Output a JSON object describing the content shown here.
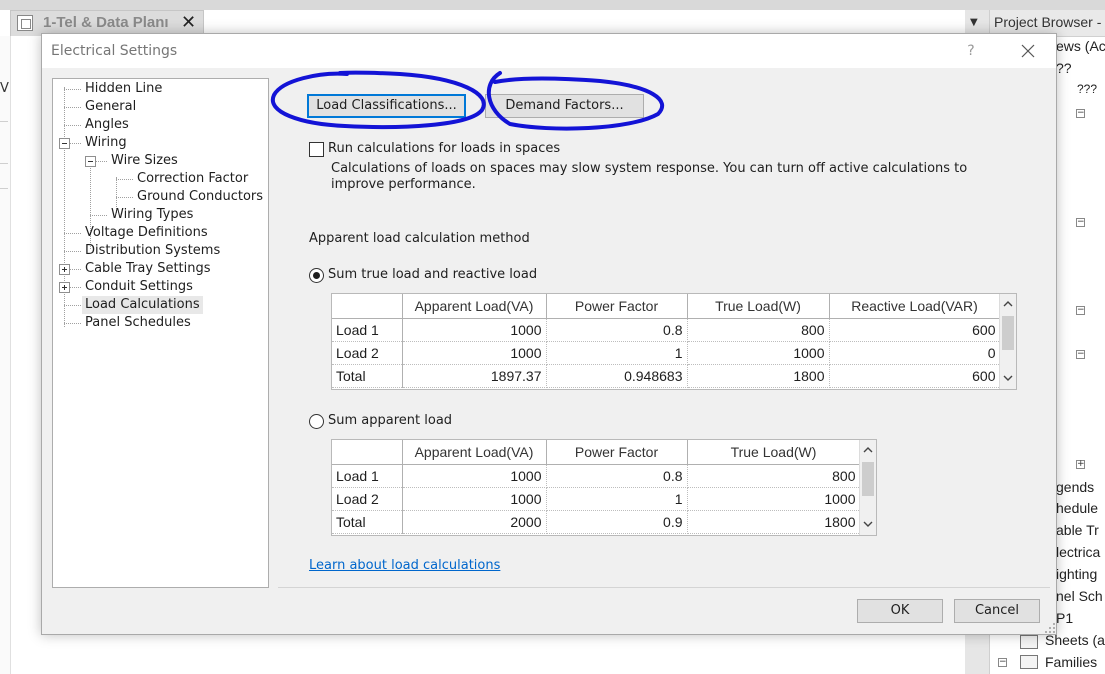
{
  "background": {
    "view_tab_title": "1-Tel & Data Planı",
    "left_mark": "V",
    "project_browser": {
      "title": "Project Browser -",
      "items": [
        "ews (Ac",
        "??",
        "???",
        "gends",
        "hedule",
        "able Tr",
        "lectrica",
        "ighting",
        "nel Sch",
        "P1",
        "Sheets (a",
        "Families"
      ]
    }
  },
  "dialog": {
    "title": "Electrical Settings",
    "help_label": "?",
    "tree": [
      "Hidden Line",
      "General",
      "Angles",
      "Wiring",
      "Wire Sizes",
      "Correction Factor",
      "Ground Conductors",
      "Wiring Types",
      "Voltage Definitions",
      "Distribution Systems",
      "Cable Tray Settings",
      "Conduit Settings",
      "Load Calculations",
      "Panel Schedules"
    ],
    "selected_tree_item": "Load Calculations",
    "load_classifications_label": "Load Classifications...",
    "demand_factors_label": "Demand Factors...",
    "run_calculations_label": "Run calculations for loads in spaces",
    "run_calculations_checked": false,
    "run_calculations_note": "Calculations of loads on spaces may slow system response. You can turn off active calculations to improve performance.",
    "method_heading": "Apparent load calculation method",
    "method_sum_true_label": "Sum true load and reactive load",
    "method_sum_apparent_label": "Sum apparent load",
    "selected_method": "Sum true load and reactive load",
    "grid_true_reactive": {
      "columns": [
        "",
        "Apparent Load(VA)",
        "Power Factor",
        "True Load(W)",
        "Reactive Load(VAR)"
      ],
      "rows": [
        [
          "Load 1",
          "1000",
          "0.8",
          "800",
          "600"
        ],
        [
          "Load 2",
          "1000",
          "1",
          "1000",
          "0"
        ],
        [
          "Total",
          "1897.37",
          "0.948683",
          "1800",
          "600"
        ]
      ]
    },
    "grid_apparent": {
      "columns": [
        "",
        "Apparent Load(VA)",
        "Power Factor",
        "True Load(W)"
      ],
      "rows": [
        [
          "Load 1",
          "1000",
          "0.8",
          "800"
        ],
        [
          "Load 2",
          "1000",
          "1",
          "1000"
        ],
        [
          "Total",
          "2000",
          "0.9",
          "1800"
        ]
      ]
    },
    "learn_link": "Learn about load calculations",
    "ok_label": "OK",
    "cancel_label": "Cancel"
  },
  "colors": {
    "focus_blue": "#0078d7",
    "link_blue": "#0066cc",
    "annotation_ink": "#1010d0",
    "dialog_bg": "#f0f0f0"
  }
}
